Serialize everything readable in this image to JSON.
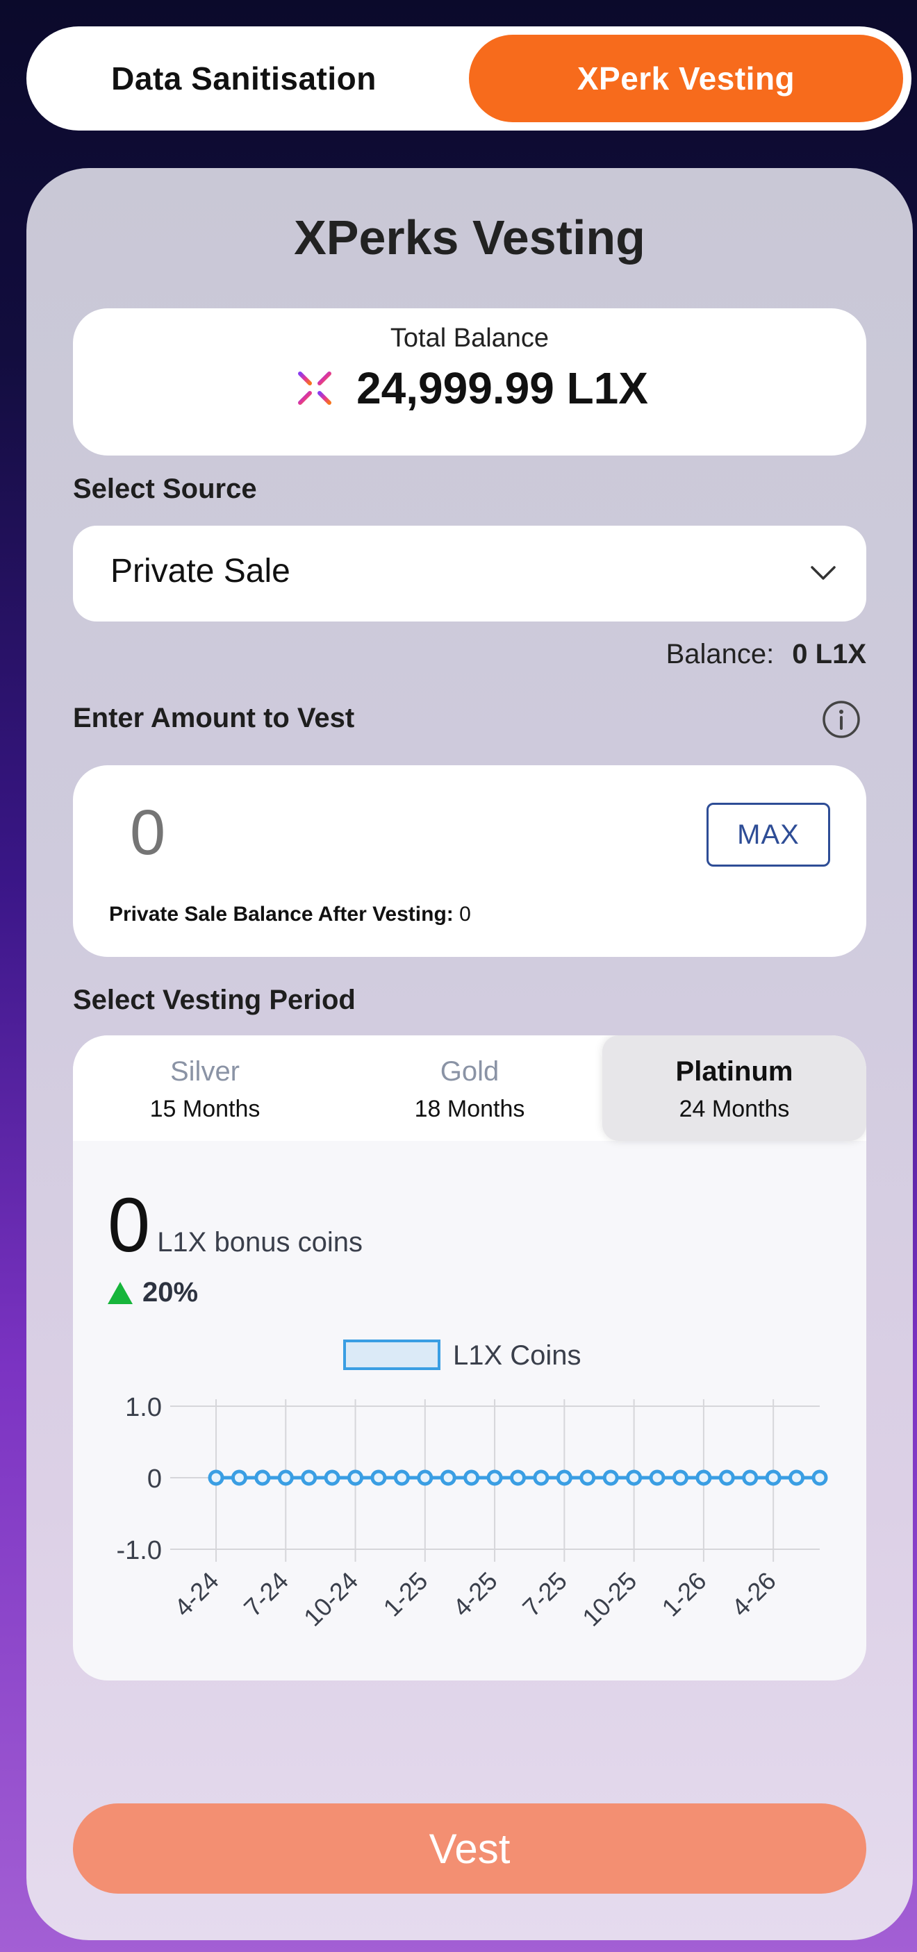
{
  "top_toggle": {
    "left_label": "Data Sanitisation",
    "right_label": "XPerk Vesting",
    "active": "right"
  },
  "card": {
    "title": "XPerks Vesting",
    "total_balance_label": "Total Balance",
    "total_balance_value": "24,999.99 L1X",
    "logo_icon": "l1x-logo-icon"
  },
  "source": {
    "label": "Select Source",
    "selected": "Private Sale",
    "balance_label": "Balance:",
    "balance_value": "0 L1X"
  },
  "amount": {
    "label": "Enter Amount to Vest",
    "placeholder": "0",
    "max_label": "MAX",
    "after_label": "Private Sale Balance After Vesting:",
    "after_value": "0"
  },
  "period": {
    "label": "Select Vesting Period",
    "tabs": [
      {
        "name": "Silver",
        "months": "15 Months",
        "active": false
      },
      {
        "name": "Gold",
        "months": "18 Months",
        "active": false
      },
      {
        "name": "Platinum",
        "months": "24 Months",
        "active": true
      }
    ],
    "bonus_value": "0",
    "bonus_text": "L1X bonus coins",
    "bonus_pct": "20%"
  },
  "chart_data": {
    "type": "line",
    "legend": "L1X Coins",
    "legend_position": "top",
    "series": [
      {
        "name": "L1X Coins",
        "values": [
          0,
          0,
          0,
          0,
          0,
          0,
          0,
          0,
          0,
          0,
          0,
          0,
          0,
          0,
          0,
          0,
          0,
          0,
          0,
          0,
          0,
          0,
          0,
          0,
          0,
          0,
          0
        ]
      }
    ],
    "x_ticks": [
      "4-24",
      "7-24",
      "10-24",
      "1-25",
      "4-25",
      "7-25",
      "10-25",
      "1-26",
      "4-26"
    ],
    "y_ticks": [
      "1.0",
      "0",
      "-1.0"
    ],
    "ylim": [
      -1,
      1
    ],
    "grid": true,
    "color": "#3a9ee3"
  },
  "vest_button": {
    "label": "Vest"
  },
  "colors": {
    "accent": "#f76b1c",
    "vest_button": "#f38f72",
    "line": "#3a9ee3",
    "up_arrow": "#17b53b"
  }
}
